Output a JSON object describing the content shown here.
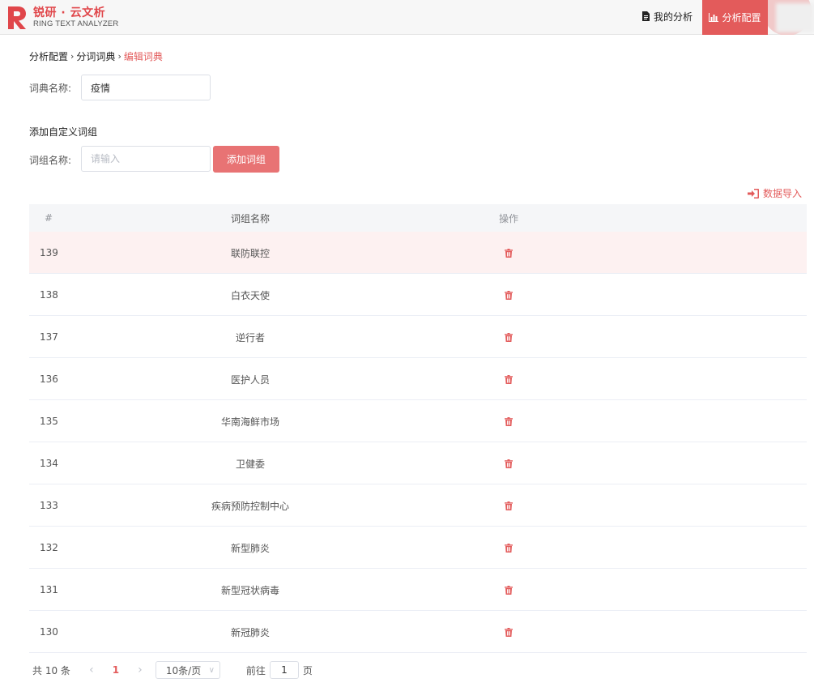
{
  "header": {
    "brand_name": "锐研 · 云文析",
    "brand_sub": "RING TEXT ANALYZER",
    "nav_my_analysis": "我的分析",
    "nav_config": "分析配置",
    "accent": "#e35b5b"
  },
  "breadcrumb": {
    "items": [
      "分析配置",
      "分词词典",
      "编辑词典"
    ]
  },
  "form": {
    "dict_name_label": "词典名称:",
    "dict_name_value": "疫情",
    "section_title": "添加自定义词组",
    "phrase_label": "词组名称:",
    "phrase_placeholder": "请输入",
    "add_button": "添加词组"
  },
  "import_label": "数据导入",
  "table": {
    "headers": {
      "index": "#",
      "name": "词组名称",
      "op": "操作"
    },
    "rows": [
      {
        "index": "139",
        "name": "联防联控"
      },
      {
        "index": "138",
        "name": "白衣天使"
      },
      {
        "index": "137",
        "name": "逆行者"
      },
      {
        "index": "136",
        "name": "医护人员"
      },
      {
        "index": "135",
        "name": "华南海鲜市场"
      },
      {
        "index": "134",
        "name": "卫健委"
      },
      {
        "index": "133",
        "name": "疾病预防控制中心"
      },
      {
        "index": "132",
        "name": "新型肺炎"
      },
      {
        "index": "131",
        "name": "新型冠状病毒"
      },
      {
        "index": "130",
        "name": "新冠肺炎"
      }
    ]
  },
  "pagination": {
    "total": "共 10 条",
    "current_page": "1",
    "page_size": "10条/页",
    "goto_prefix": "前往",
    "goto_value": "1",
    "goto_suffix": "页"
  }
}
